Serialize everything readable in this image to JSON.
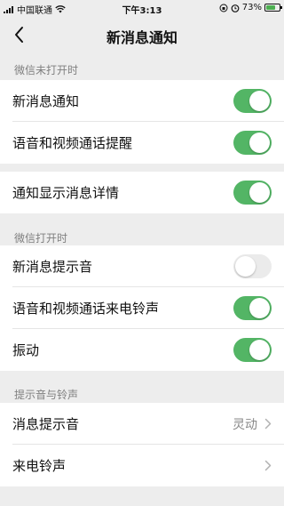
{
  "status_bar": {
    "carrier": "中国联通",
    "time": "下午3:13",
    "battery": "73%",
    "battery_level": 0.73
  },
  "nav": {
    "title": "新消息通知",
    "back_icon": "chevron-left-icon"
  },
  "sections": {
    "closed": {
      "header": "微信未打开时"
    },
    "open": {
      "header": "微信打开时"
    },
    "sounds": {
      "header": "提示音与铃声"
    }
  },
  "rows": {
    "new_message": {
      "label": "新消息通知",
      "on": true
    },
    "call_reminder": {
      "label": "语音和视频通话提醒",
      "on": true
    },
    "show_details": {
      "label": "通知显示消息详情",
      "on": true
    },
    "message_sound": {
      "label": "新消息提示音",
      "on": false
    },
    "call_ringtone": {
      "label": "语音和视频通话来电铃声",
      "on": true
    },
    "vibration": {
      "label": "振动",
      "on": true
    },
    "notification_tone": {
      "label": "消息提示音",
      "value": "灵动"
    },
    "incoming_ringtone": {
      "label": "来电铃声"
    }
  },
  "colors": {
    "toggle_on": "#53b565",
    "toggle_off": "#ebebeb",
    "background": "#ededed"
  }
}
